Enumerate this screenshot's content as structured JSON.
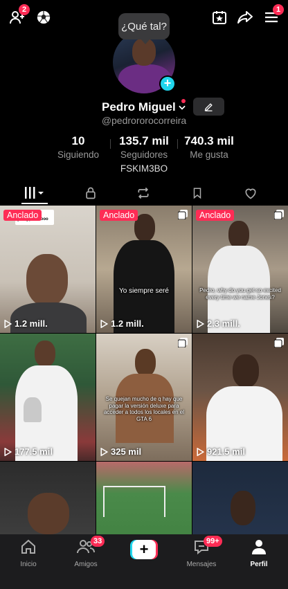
{
  "header": {
    "add_friends_badge": "2",
    "menu_badge": "1",
    "tooltip": "¿Qué tal?"
  },
  "profile": {
    "name": "Pedro Miguel",
    "handle": "@pedrororocorreira",
    "bio": "FSKIM3BO"
  },
  "stats": [
    {
      "value": "10",
      "label": "Siguiendo"
    },
    {
      "value": "135.7 mil",
      "label": "Seguidores"
    },
    {
      "value": "740.3 mil",
      "label": "Me gusta"
    }
  ],
  "tabs": [
    {
      "icon": "grid-icon",
      "active": true
    },
    {
      "icon": "lock-icon",
      "active": false
    },
    {
      "icon": "repost-icon",
      "active": false
    },
    {
      "icon": "bookmark-icon",
      "active": false
    },
    {
      "icon": "heart-icon",
      "active": false
    }
  ],
  "videos": [
    {
      "pinned": "Anclado",
      "views": "1.2 mill.",
      "caption": "",
      "overlay": "[foto] pedroooo"
    },
    {
      "pinned": "Anclado",
      "views": "1.2 mill.",
      "caption": "Yo siempre seré"
    },
    {
      "pinned": "Anclado",
      "views": "2.3 mill.",
      "caption": "Pedro, why do you get so excited every time we name Jones?"
    },
    {
      "pinned": "",
      "views": "177.5 mil",
      "caption": ""
    },
    {
      "pinned": "",
      "views": "325 mil",
      "caption": "Se quejan mucho de q hay que pagar la versión deluxe para acceder a todos los locales en el GTA 6"
    },
    {
      "pinned": "",
      "views": "921.5 mil",
      "caption": ""
    },
    {
      "pinned": "",
      "views": "",
      "caption": ""
    },
    {
      "pinned": "",
      "views": "",
      "caption": ""
    },
    {
      "pinned": "",
      "views": "",
      "caption": ""
    }
  ],
  "bottom_nav": {
    "home": "Inicio",
    "friends": "Amigos",
    "friends_badge": "33",
    "create": "+",
    "messages": "Mensajes",
    "messages_badge": "99+",
    "profile": "Perfil"
  },
  "colors": {
    "accent": "#fe2c55",
    "cyan": "#20d5ec",
    "background": "#000000",
    "nav_background": "#1c1c1e"
  }
}
